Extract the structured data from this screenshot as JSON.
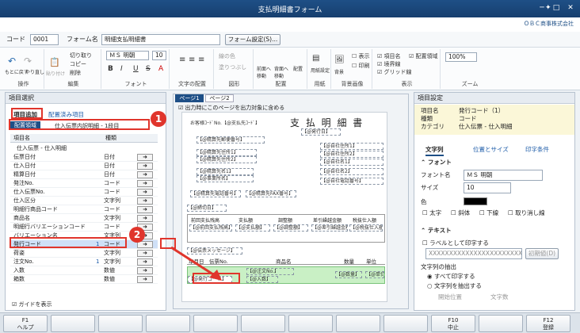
{
  "window": {
    "title": "支払明細書フォーム",
    "brand": "ＯＢＣ商事株式会社",
    "logo": "✦"
  },
  "header": {
    "code_label": "コード",
    "code_value": "0001",
    "form_label": "フォーム名",
    "form_value": "明細支払明細書",
    "form_settings_button": "フォーム設定(S)..."
  },
  "ribbon": {
    "operate": {
      "label": "操作",
      "undo": "もとに戻す",
      "redo": "やり直し"
    },
    "edit": {
      "label": "編集",
      "paste": "貼り付け",
      "cut": "切り取り",
      "copy": "コピー",
      "delete": "削除"
    },
    "font": {
      "label": "フォント",
      "name": "ＭＳ 明朝",
      "size": "10",
      "bold": "B",
      "italic": "I",
      "underline": "U",
      "strike": "S",
      "color": "A"
    },
    "text_layout": {
      "label": "文字の配置"
    },
    "shape": {
      "label": "図形",
      "line_color": "線の色",
      "fill": "塗りつぶし"
    },
    "arrange": {
      "label": "配置",
      "front": "前面へ移動",
      "back": "背面へ移動",
      "align": "配置"
    },
    "paper": {
      "label": "用紙",
      "setting": "用紙設定"
    },
    "background": {
      "label": "背景画像",
      "bg": "背景",
      "show": "表示",
      "print": "印刷"
    },
    "display": {
      "label": "表示",
      "item_name": "項目名",
      "boundary": "境界線",
      "grid": "グリッド線",
      "layout_area": "配置領域"
    },
    "zoom": {
      "label": "ズーム",
      "value": "100%"
    }
  },
  "left_panel": {
    "title": "項目選択",
    "tab_add": "項目追加",
    "tab_placed": "配置済み項目",
    "area_label": "配置領域",
    "area_value": "仕入伝票内訳明細 - 1段目",
    "col_name": "項目名",
    "col_type": "種類",
    "group": "仕入伝票 - 仕入明細",
    "rows": [
      {
        "name": "伝票日付",
        "type": "日付"
      },
      {
        "name": "仕入日付",
        "type": "日付"
      },
      {
        "name": "精算日付",
        "type": "日付"
      },
      {
        "name": "発注No.",
        "type": "コード"
      },
      {
        "name": "仕入伝票No.",
        "type": "コード"
      },
      {
        "name": "仕入区分",
        "type": "文字列"
      },
      {
        "name": "明細行商品コード",
        "type": "コード"
      },
      {
        "name": "商品名",
        "type": "文字列"
      },
      {
        "name": "明細行バリエーションコード",
        "type": "コード"
      },
      {
        "name": "バリエーション名",
        "type": "文字列"
      },
      {
        "name": "発行コード",
        "type": "コード",
        "badge": "1"
      },
      {
        "name": "荷姿",
        "type": "文字列"
      },
      {
        "name": "注文No.",
        "type": "文字列",
        "badge": "1"
      },
      {
        "name": "入数",
        "type": "数値"
      },
      {
        "name": "箱数",
        "type": "数値"
      }
    ],
    "guide": "ガイドを表示",
    "add_arrow": "➜"
  },
  "preview": {
    "tab1": "ページ1",
    "tab2": "ページ2",
    "checkbox": "出力時にこのページを出力対象に含める",
    "doc_title": "支 払 明 細 書",
    "fields": {
      "code": "お客様ｺｰﾄﾞNo.【@支払先ｺｰﾄﾞ】",
      "issue": "【@発行日】",
      "payee_zip": "【@精算先郵便番号】",
      "addr1": "【@精算先住所1】",
      "addr2": "【@精算先住所2】",
      "name1": "【@精算先名1】",
      "name2": "【@事業所名】",
      "tel": "【@精算先電話番号】",
      "fax": "【@精算先FAX番号】",
      "deadline": "【@締切日】",
      "c1": "【@自社住所1】",
      "c2": "【@自社住所2】",
      "c3": "【@自社名1】",
      "c4": "【@自社名2】",
      "c5": "【@自社電話番号】",
      "msg": "【@伝票メッセージ】",
      "h1": "前回支払残高",
      "h2": "支払額",
      "h3": "調整額",
      "h4": "差引繰越金額",
      "h5": "税抜仕入額",
      "v1": "【@前回支払残高】",
      "v2": "【@支払額】",
      "v3": "【@調整額】",
      "v4": "【@差引繰越金額】",
      "v5": "【@税抜仕入額】",
      "col_date": "年月日",
      "col_slip": "伝票No.",
      "col_item": "商品名",
      "col_qty": "数量",
      "col_unit": "単位",
      "r1": "【@注文No.】",
      "r2": "【@発行コード】",
      "r3": "【@入数】",
      "r4": "【@数量】",
      "r5": "【@単位】"
    }
  },
  "right_panel": {
    "title": "項目設定",
    "item_label": "項目名",
    "item_value": "発行コード（1）",
    "kind_label": "種類",
    "kind_value": "コード",
    "cat_label": "カテゴリ",
    "cat_value": "仕入伝票 - 仕入明細",
    "tabs": [
      "文字列",
      "位置とサイズ",
      "印字条件"
    ],
    "font_section": "フォント",
    "font_name_label": "フォント名",
    "font_name": "ＭＳ 明朝",
    "size_label": "サイズ",
    "size": "10",
    "color_label": "色",
    "bold": "太字",
    "italic": "斜体",
    "underline": "下線",
    "strike": "取り消し線",
    "text_section": "テキスト",
    "print_as_label": "ラベルとして印字する",
    "placeholder_x": "XXXXXXXXXXXXXXXXXXXXXXX",
    "init_button": "初期値(D)",
    "extract_label": "文字列の抽出",
    "print_all": "すべて印字する",
    "extract": "文字列を抽出する",
    "start_pos": "開始位置",
    "char_count": "文字数"
  },
  "fkeys": [
    {
      "key": "F1",
      "label": "ヘルプ"
    },
    {
      "key": "F10",
      "label": "中止"
    },
    {
      "key": "F12",
      "label": "登録"
    }
  ],
  "callouts": [
    "1",
    "2"
  ]
}
